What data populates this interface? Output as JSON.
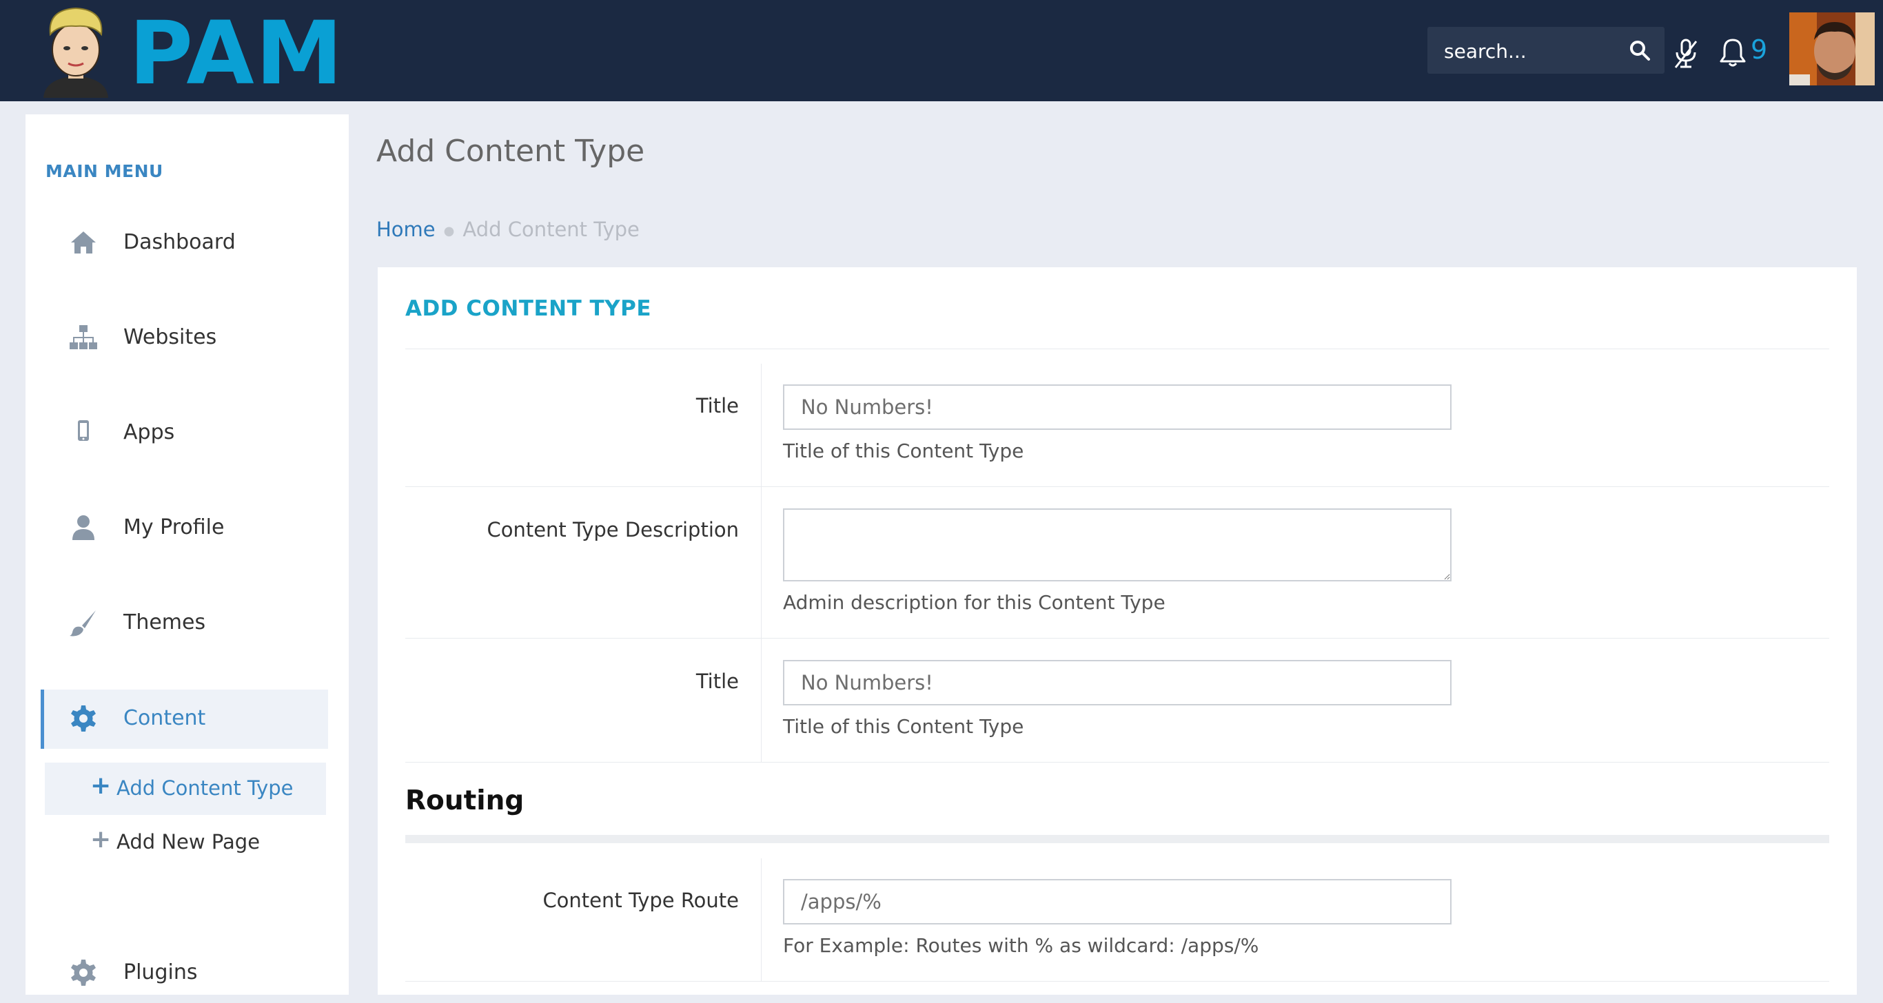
{
  "header": {
    "brand": "PAM",
    "search": {
      "placeholder": "search..."
    },
    "notification_count": "9"
  },
  "sidebar": {
    "title": "MAIN MENU",
    "items": [
      {
        "label": "Dashboard",
        "icon": "home-icon"
      },
      {
        "label": "Websites",
        "icon": "sitemap-icon"
      },
      {
        "label": "Apps",
        "icon": "mobile-icon"
      },
      {
        "label": "My Profile",
        "icon": "user-icon"
      },
      {
        "label": "Themes",
        "icon": "brush-icon"
      },
      {
        "label": "Content",
        "icon": "gear-icon",
        "active": true
      },
      {
        "label": "Plugins",
        "icon": "gear-icon"
      }
    ],
    "sub_items": [
      {
        "label": "Add Content Type",
        "active": true
      },
      {
        "label": "Add New Page"
      }
    ]
  },
  "page": {
    "title": "Add Content Type",
    "breadcrumb": {
      "home": "Home",
      "current": "Add Content Type"
    }
  },
  "form": {
    "heading": "ADD CONTENT TYPE",
    "fields": [
      {
        "label": "Title",
        "placeholder": "No Numbers!",
        "help": "Title of this Content Type"
      },
      {
        "label": "Content Type Description",
        "placeholder": "",
        "help": "Admin description for this Content Type"
      },
      {
        "label": "Title",
        "placeholder": "No Numbers!",
        "help": "Title of this Content Type"
      }
    ],
    "routing": {
      "heading": "Routing",
      "field": {
        "label": "Content Type Route",
        "placeholder": "/apps/%",
        "help": "For Example: Routes with % as wildcard: /apps/%"
      }
    }
  },
  "colors": {
    "topbar": "#1b2942",
    "brand": "#0aa0d4",
    "accent": "#3a86c2",
    "card_heading": "#1aa3c8"
  }
}
